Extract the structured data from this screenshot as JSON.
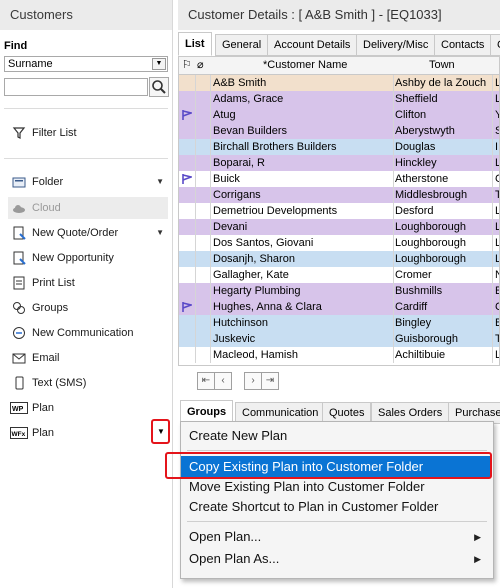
{
  "sidebar": {
    "title": "Customers",
    "find_label": "Find",
    "search_field_selected": "Surname",
    "search_query": "",
    "filter_label": "Filter List",
    "items": [
      {
        "label": "Folder",
        "has_dropdown": true
      },
      {
        "label": "Cloud",
        "disabled": true
      },
      {
        "label": "New Quote/Order",
        "has_dropdown": true
      },
      {
        "label": "New Opportunity"
      },
      {
        "label": "Print List"
      },
      {
        "label": "Groups"
      },
      {
        "label": "New Communication"
      },
      {
        "label": "Email"
      },
      {
        "label": "Text (SMS)"
      },
      {
        "label": "Plan",
        "icon_text": "WP"
      },
      {
        "label": "Plan",
        "icon_text": "WFx",
        "has_dropdown": true
      }
    ]
  },
  "main": {
    "title": "Customer Details : [ A&B Smith ]  -  [EQ1033]",
    "tabs": [
      "List",
      "General",
      "Account Details",
      "Delivery/Misc",
      "Contacts",
      "C"
    ],
    "grid": {
      "headers": [
        "*Customer Name",
        "Town"
      ],
      "rows": [
        {
          "name": "A&B Smith",
          "town": "Ashby de la Zouch",
          "extra": "L",
          "color": "#f2e0cc",
          "flag": false
        },
        {
          "name": "Adams, Grace",
          "town": "Sheffield",
          "extra": "L",
          "color": "#d7c4ea",
          "flag": false
        },
        {
          "name": "Atug",
          "town": "Clifton",
          "extra": "Y",
          "color": "#d7c4ea",
          "flag": true
        },
        {
          "name": "Bevan Builders",
          "town": "Aberystwyth",
          "extra": "S",
          "color": "#d7c4ea",
          "flag": false
        },
        {
          "name": "Birchall Brothers Builders",
          "town": "Douglas",
          "extra": "I",
          "color": "#c8def2",
          "flag": false
        },
        {
          "name": "Boparai, R",
          "town": "Hinckley",
          "extra": "L",
          "color": "#d7c4ea",
          "flag": false
        },
        {
          "name": "Buick",
          "town": "Atherstone",
          "extra": "C",
          "color": "#ffffff",
          "flag": true
        },
        {
          "name": "Corrigans",
          "town": "Middlesbrough",
          "extra": "T",
          "color": "#d7c4ea",
          "flag": false
        },
        {
          "name": "Demetriou Developments",
          "town": "Desford",
          "extra": "L",
          "color": "#ffffff",
          "flag": false
        },
        {
          "name": "Devani",
          "town": "Loughborough",
          "extra": "L",
          "color": "#d7c4ea",
          "flag": false
        },
        {
          "name": "Dos Santos, Giovani",
          "town": "Loughborough",
          "extra": "L",
          "color": "#ffffff",
          "flag": false
        },
        {
          "name": "Dosanjh, Sharon",
          "town": "Loughborough",
          "extra": "L",
          "color": "#c8def2",
          "flag": false
        },
        {
          "name": "Gallagher, Kate",
          "town": "Cromer",
          "extra": "N",
          "color": "#ffffff",
          "flag": false
        },
        {
          "name": "Hegarty Plumbing",
          "town": "Bushmills",
          "extra": "E",
          "color": "#d7c4ea",
          "flag": false
        },
        {
          "name": "Hughes, Anna & Clara",
          "town": "Cardiff",
          "extra": "C",
          "color": "#d7c4ea",
          "flag": true
        },
        {
          "name": "Hutchinson",
          "town": "Bingley",
          "extra": "B",
          "color": "#c8def2",
          "flag": false
        },
        {
          "name": "Juskevic",
          "town": "Guisborough",
          "extra": "T",
          "color": "#c8def2",
          "flag": false
        },
        {
          "name": "Macleod, Hamish",
          "town": "Achiltibuie",
          "extra": "L",
          "color": "#ffffff",
          "flag": false
        }
      ]
    },
    "bottom_tabs": [
      "Groups",
      "Communication",
      "Quotes",
      "Sales Orders",
      "Purchase"
    ]
  },
  "context_menu": {
    "items": [
      {
        "label": "Create New Plan"
      },
      {
        "label": "Copy Existing Plan into Customer Folder",
        "highlighted": true
      },
      {
        "label": "Move Existing Plan into Customer Folder"
      },
      {
        "label": "Create Shortcut to Plan in Customer Folder"
      },
      {
        "label": "Open Plan...",
        "submenu": true
      },
      {
        "label": "Open Plan As...",
        "submenu": true
      }
    ]
  },
  "colors": {
    "highlight": "#0a74d4",
    "callout": "#e4141b",
    "flag": "#5a4ac8"
  }
}
